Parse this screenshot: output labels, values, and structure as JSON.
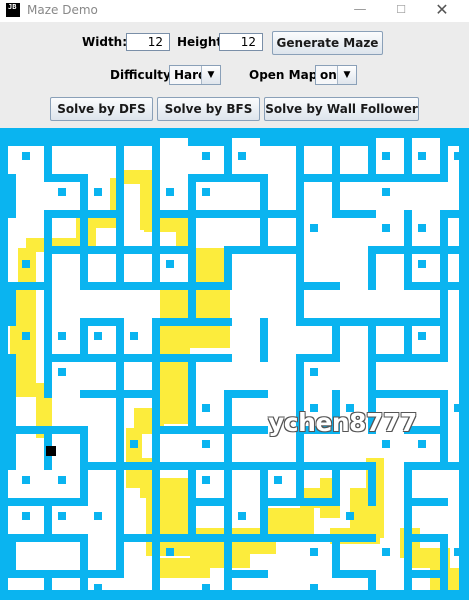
{
  "window": {
    "title": "Maze Demo",
    "icon_label": "JB",
    "controls": {
      "minimize": "—",
      "maximize": "☐",
      "close": "✕"
    }
  },
  "controls": {
    "width_label": "Width:",
    "width_value": "12",
    "height_label": "Height:",
    "height_value": "12",
    "generate_label": "Generate Maze",
    "difficulty_label": "Difficulty:",
    "difficulty_value": "Hard",
    "open_map_label": "Open Map:",
    "open_map_value": "on",
    "solve_dfs_label": "Solve by DFS",
    "solve_bfs_label": "Solve by BFS",
    "solve_wall_label": "Solve by Wall Follower"
  },
  "maze": {
    "watermark": "ychen8777",
    "colors": {
      "wall": "#0ab4f0",
      "path": "#fcec3c",
      "floor": "#ffffff",
      "marker": "#000000"
    }
  }
}
